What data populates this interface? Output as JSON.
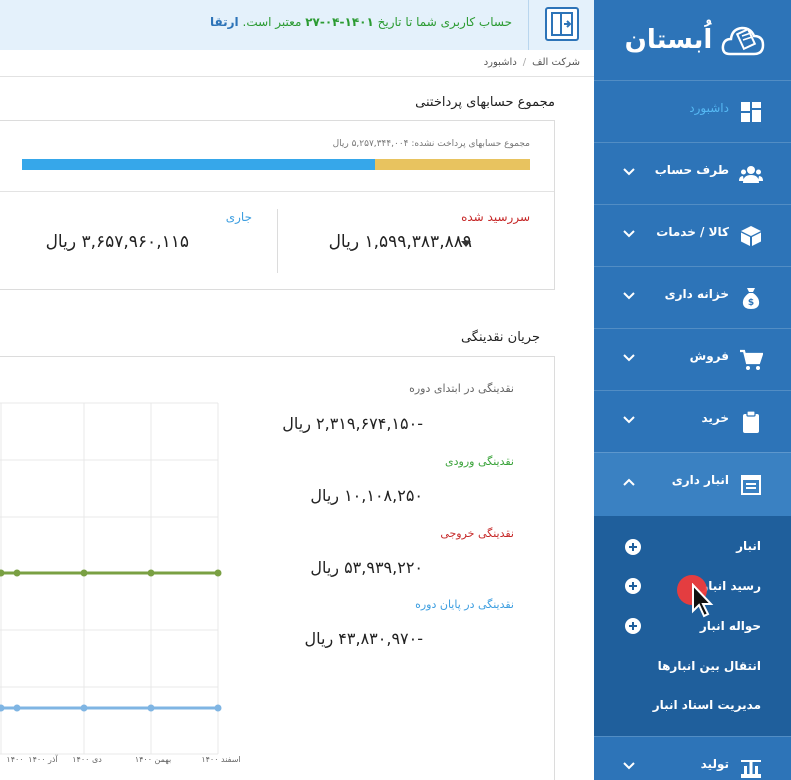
{
  "banner": {
    "text": "حساب کاربری شما تا تاریخ",
    "date": "۱۴۰۱-۰۴-۲۷",
    "suffix": "معتبر است.",
    "upgrade": "ارتقا"
  },
  "breadcrumb": {
    "company": "شرکت الف",
    "sep": "/",
    "page": "داشبورد"
  },
  "logo": {
    "text": "اُبستان"
  },
  "payables": {
    "title": "مجموع حسابهای پرداختنی",
    "unpaid_text": "مجموع حسابهای پرداخت نشده: ۵,۲۵۷,۳۴۴,۰۰۴ ریال",
    "bar_fraction": 0.695,
    "overdue_label": "سررسید شده",
    "overdue_value": "۱,۵۹۹,۳۸۳,۸۸۹ ریال",
    "current_label": "جاری",
    "current_value": "۳,۶۵۷,۹۶۰,۱۱۵ ریال"
  },
  "cashflow": {
    "title": "جریان نقدینگی",
    "items": [
      {
        "label": "نقدینگی در ابتدای دوره",
        "value": "-۲,۳۱۹,۶۷۴,۱۵۰ ریال",
        "color": "#666666"
      },
      {
        "label": "نقدینگی ورودی",
        "value": "۱۰,۱۰۸,۲۵۰ ریال",
        "color": "#3aa33a"
      },
      {
        "label": "نقدینگی خروجی",
        "value": "۵۳,۹۳۹,۲۲۰ ریال",
        "color": "#c62828"
      },
      {
        "label": "نقدینگی در پایان دوره",
        "value": "-۴۳,۸۳۰,۹۷۰ ریال",
        "color": "#3d9ee0"
      }
    ]
  },
  "chart_data": {
    "type": "line",
    "categories": [
      "آذر ۱۴۰۰",
      "دی ۱۴۰۰",
      "بهمن ۱۴۰۰",
      "اسفند ۱۴۰۰"
    ],
    "visible_tick_labels": [
      "۱۴۰۰",
      "آذر ۱۴۰۰",
      "دی ۱۴۰۰",
      "بهمن ۱۴۰۰",
      "اسفند ۱۴۰۰"
    ],
    "series": [
      {
        "color": "#7aa043",
        "values": [
          1,
          1,
          1,
          1,
          1
        ]
      },
      {
        "color": "#7fb5e3",
        "values": [
          0,
          0,
          0,
          0,
          0
        ]
      }
    ],
    "grid": true
  },
  "sidebar": {
    "items": [
      {
        "label": "داشبورد",
        "icon": "dashboard-icon",
        "active": true
      },
      {
        "label": "طرف حساب",
        "icon": "users-icon"
      },
      {
        "label": "کالا / خدمات",
        "icon": "box-icon"
      },
      {
        "label": "خزانه داری",
        "icon": "money-bag-icon"
      },
      {
        "label": "فروش",
        "icon": "cart-icon"
      },
      {
        "label": "خرید",
        "icon": "clipboard-icon"
      },
      {
        "label": "انبار داری",
        "icon": "warehouse-icon",
        "open": true
      },
      {
        "label": "تولید",
        "icon": "factory-icon"
      }
    ],
    "submenu": [
      {
        "label": "انبار",
        "plus": true
      },
      {
        "label": "رسید انبار",
        "plus": true
      },
      {
        "label": "حواله انبار",
        "plus": true
      },
      {
        "label": "انتقال بین انبارها",
        "plus": false
      },
      {
        "label": "مدیریت اسناد انبار",
        "plus": false
      }
    ]
  },
  "colors": {
    "sidebar": "#2d74b8",
    "submenu": "#1f5f9c",
    "accent": "#36a7ea",
    "bar_rest": "#e8c35f"
  }
}
